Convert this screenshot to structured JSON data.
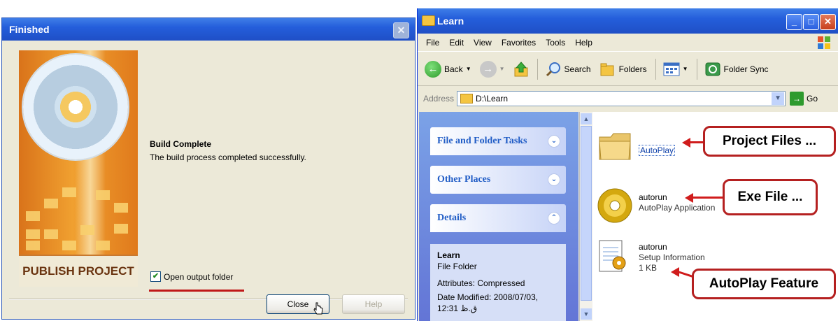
{
  "dialog": {
    "title": "Finished",
    "banner_label": "PUBLISH PROJECT",
    "build_title": "Build Complete",
    "build_message": "The build process completed successfully.",
    "open_output_label": "Open output folder",
    "open_output_checked": true,
    "close_label": "Close",
    "help_label": "Help"
  },
  "explorer": {
    "title": "Learn",
    "menu": [
      "File",
      "Edit",
      "View",
      "Favorites",
      "Tools",
      "Help"
    ],
    "toolbar": {
      "back": "Back",
      "search": "Search",
      "folders": "Folders",
      "folder_sync": "Folder Sync"
    },
    "address": {
      "label": "Address",
      "path": "D:\\Learn",
      "go": "Go"
    },
    "tasks": {
      "file_folder": "File and Folder Tasks",
      "other_places": "Other Places",
      "details": "Details",
      "details_name": "Learn",
      "details_type": "File Folder",
      "details_attributes": "Attributes: Compressed",
      "details_modified": "Date Modified: 2008/07/03, 12:31 ق.ظ"
    },
    "files": [
      {
        "name": "AutoPlay"
      },
      {
        "name": "autorun",
        "type": "AutoPlay Application"
      },
      {
        "name": "autorun",
        "type": "Setup Information",
        "size": "1 KB"
      }
    ],
    "callouts": {
      "project_files": "Project Files ...",
      "exe_file": "Exe File ...",
      "autoplay_feature": "AutoPlay Feature"
    }
  },
  "colors": {
    "titlebar": "#245edb",
    "callout_red": "#c01818",
    "dialog_bg": "#ece9d8",
    "taskpane_blue": "#6375d6"
  }
}
